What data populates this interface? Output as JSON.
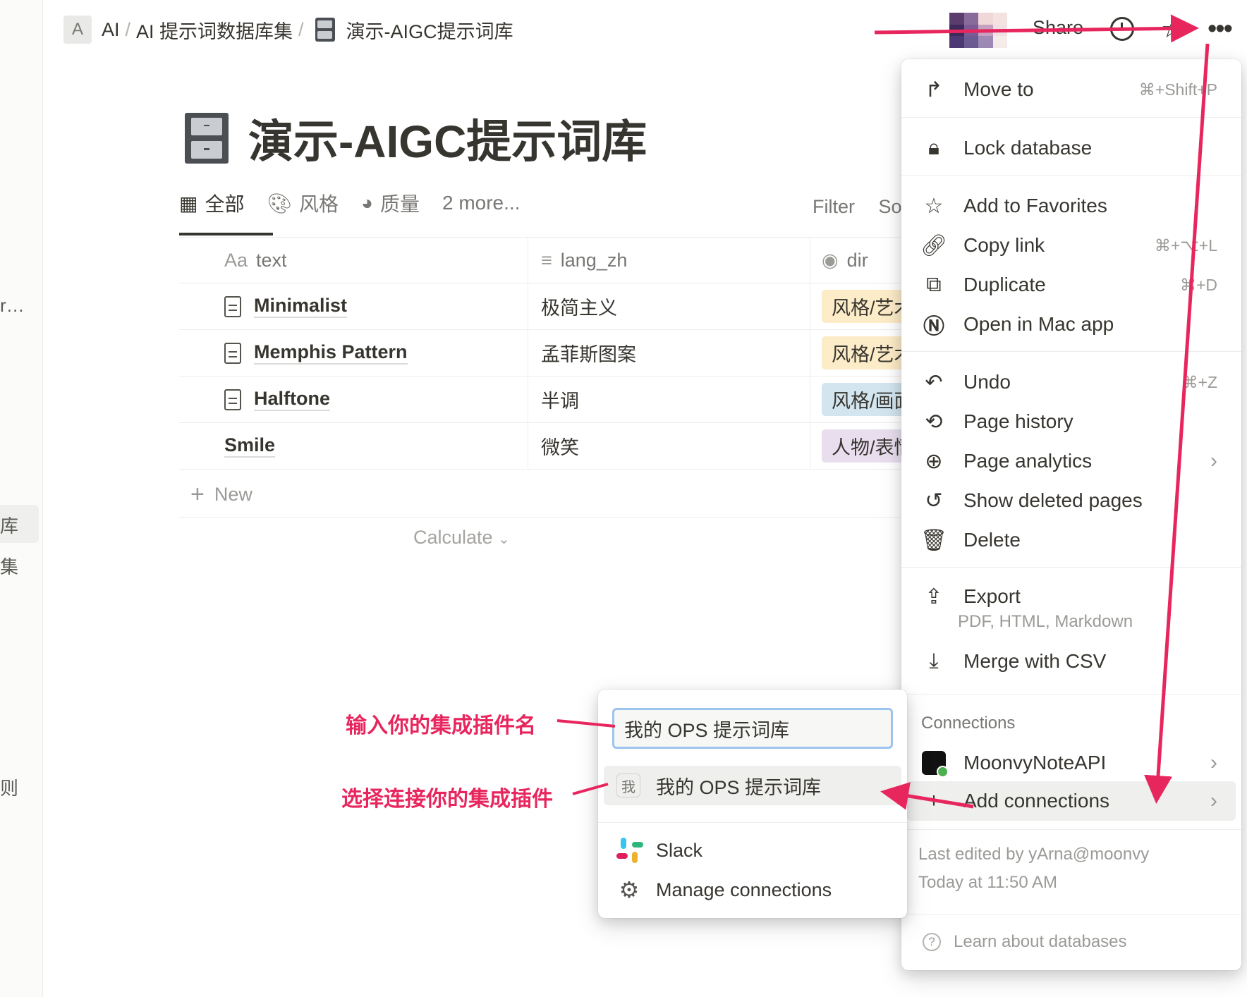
{
  "sidebar": {
    "fragments": [
      "r…",
      "库",
      "集",
      "则"
    ]
  },
  "breadcrumb": {
    "workspace_initial": "A",
    "items": [
      "AI",
      "AI 提示词数据库集",
      "演示-AIGC提示词库"
    ],
    "separator": "/"
  },
  "topbar": {
    "share_label": "Share"
  },
  "page": {
    "title": "演示-AIGC提示词库",
    "icon": "file-cabinet-icon"
  },
  "views": {
    "tabs": [
      {
        "label": "全部",
        "icon": "table-icon"
      },
      {
        "label": "风格",
        "icon": "palette-icon"
      },
      {
        "label": "质量",
        "icon": "quality-icon"
      }
    ],
    "more": "2 more...",
    "filter": "Filter",
    "sort": "So"
  },
  "table": {
    "columns": [
      {
        "icon": "Aa",
        "label": "text"
      },
      {
        "icon": "≡",
        "label": "lang_zh"
      },
      {
        "icon": "◉",
        "label": "dir"
      }
    ],
    "rows": [
      {
        "text": "Minimalist",
        "lang_zh": "极简主义",
        "dir": "风格/艺术",
        "tag_color": "#fdecc8",
        "has_doc": true
      },
      {
        "text": "Memphis Pattern",
        "lang_zh": "孟菲斯图案",
        "dir": "风格/艺术",
        "tag_color": "#fdecc8",
        "has_doc": true
      },
      {
        "text": "Halftone",
        "lang_zh": "半调",
        "dir": "风格/画面",
        "tag_color": "#d3e5ef",
        "has_doc": true
      },
      {
        "text": "Smile",
        "lang_zh": "微笑",
        "dir": "人物/表情",
        "tag_color": "#e8deee",
        "has_doc": false
      }
    ],
    "new_label": "New",
    "calculate_label": "Calculate"
  },
  "menu": {
    "move_to": {
      "label": "Move to",
      "shortcut": "⌘+Shift+P"
    },
    "lock": {
      "label": "Lock database"
    },
    "favorites": {
      "label": "Add to Favorites"
    },
    "copy_link": {
      "label": "Copy link",
      "shortcut": "⌘+⌥+L"
    },
    "duplicate": {
      "label": "Duplicate",
      "shortcut": "⌘+D"
    },
    "open_mac": {
      "label": "Open in Mac app"
    },
    "undo": {
      "label": "Undo",
      "shortcut": "⌘+Z"
    },
    "page_history": {
      "label": "Page history"
    },
    "page_analytics": {
      "label": "Page analytics"
    },
    "show_deleted": {
      "label": "Show deleted pages"
    },
    "delete": {
      "label": "Delete"
    },
    "export": {
      "label": "Export",
      "sub": "PDF, HTML, Markdown"
    },
    "merge_csv": {
      "label": "Merge with CSV"
    },
    "connections_label": "Connections",
    "moonvy_api": {
      "label": "MoonvyNoteAPI"
    },
    "add_connections": {
      "label": "Add connections"
    },
    "last_edited": "Last edited by yArna@moonvy",
    "last_edited_time": "Today at 11:50 AM",
    "learn": "Learn about databases"
  },
  "connections_popup": {
    "search_value": "我的 OPS 提示词库",
    "result_badge": "我",
    "result_label": "我的 OPS 提示词库",
    "slack_label": "Slack",
    "manage_label": "Manage connections"
  },
  "annotations": {
    "input_hint": "输入你的集成插件名",
    "select_hint": "选择连接你的集成插件"
  },
  "colors": {
    "annotation": "#e8265e",
    "input_focus": "#9cc4ef"
  }
}
